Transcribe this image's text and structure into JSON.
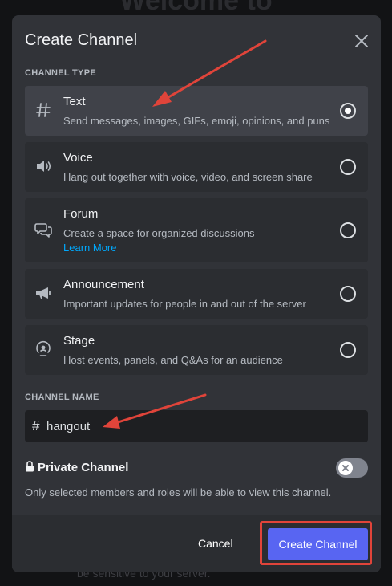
{
  "background": {
    "title_fragment": "Welcome to",
    "footer_fragment": "be sensitive to your server."
  },
  "modal": {
    "title": "Create Channel",
    "channel_type_label": "CHANNEL TYPE",
    "options": [
      {
        "title": "Text",
        "desc": "Send messages, images, GIFs, emoji, opinions, and puns",
        "icon": "hash-icon",
        "selected": true
      },
      {
        "title": "Voice",
        "desc": "Hang out together with voice, video, and screen share",
        "icon": "speaker-icon",
        "selected": false
      },
      {
        "title": "Forum",
        "desc": "Create a space for organized discussions",
        "link": "Learn More",
        "icon": "forum-icon",
        "selected": false
      },
      {
        "title": "Announcement",
        "desc": "Important updates for people in and out of the server",
        "icon": "megaphone-icon",
        "selected": false
      },
      {
        "title": "Stage",
        "desc": "Host events, panels, and Q&As for an audience",
        "icon": "stage-icon",
        "selected": false
      }
    ],
    "channel_name_label": "CHANNEL NAME",
    "channel_name_prefix": "#",
    "channel_name_value": "hangout",
    "private_label": "Private Channel",
    "private_enabled": false,
    "private_desc": "Only selected members and roles will be able to view this channel.",
    "cancel_label": "Cancel",
    "create_label": "Create Channel"
  },
  "colors": {
    "modal_bg": "#313338",
    "option_bg": "#2b2d31",
    "option_selected_bg": "#404249",
    "accent": "#5865f2",
    "link": "#00a8fc",
    "annotation": "#e0443a"
  }
}
